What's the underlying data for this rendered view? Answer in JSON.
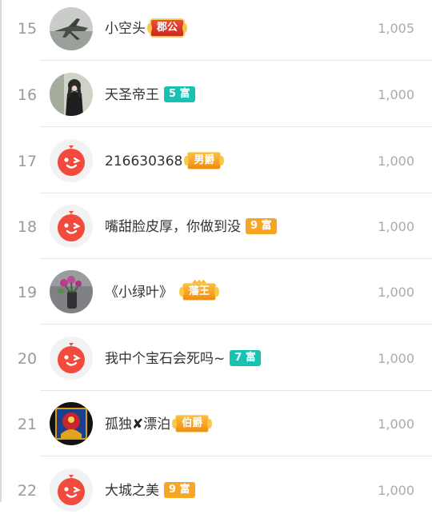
{
  "rows": [
    {
      "rank": "15",
      "name": "小空头",
      "badge": {
        "text": "郡公",
        "style": "title-red"
      },
      "score": "1,005",
      "avatar": "airplane-avatar"
    },
    {
      "rank": "16",
      "name": "天圣帝王",
      "badge": {
        "text": "5 富",
        "style": "fu-teal"
      },
      "score": "1,000",
      "avatar": "girl-photo-avatar"
    },
    {
      "rank": "17",
      "name": "216630368",
      "badge": {
        "text": "男爵",
        "style": "title-orange"
      },
      "score": "1,000",
      "avatar": "default-face-avatar"
    },
    {
      "rank": "18",
      "name": "嘴甜脸皮厚，你做到没",
      "badge": {
        "text": "9 富",
        "style": "fu-orange"
      },
      "score": "1,000",
      "avatar": "default-face-avatar"
    },
    {
      "rank": "19",
      "name": "《小绿叶》",
      "badge": {
        "text": "藩王",
        "style": "title-orange"
      },
      "score": "1,000",
      "avatar": "flower-vase-avatar"
    },
    {
      "rank": "20",
      "name": "我中个宝石会死吗~",
      "badge": {
        "text": "7 富",
        "style": "fu-teal"
      },
      "score": "1,000",
      "avatar": "default-face-avatar"
    },
    {
      "rank": "21",
      "name_parts": [
        "孤独",
        "✘",
        "漂泊"
      ],
      "badge": {
        "text": "伯爵",
        "style": "title-orange"
      },
      "score": "1,000",
      "avatar": "colorful-art-avatar"
    },
    {
      "rank": "22",
      "name": "大城之美",
      "badge": {
        "text": "9 富",
        "style": "fu-orange"
      },
      "score": "1,000",
      "avatar": "default-face-avatar"
    }
  ],
  "colors": {
    "accent_red": "#f04a3a",
    "teal": "#16c2b2",
    "orange": "#f6a623"
  }
}
